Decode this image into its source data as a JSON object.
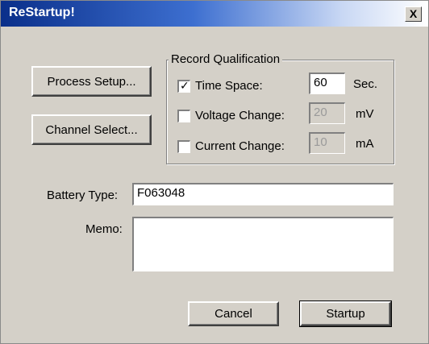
{
  "window": {
    "title": "ReStartup!",
    "close_label": "X"
  },
  "buttons": {
    "process_setup": "Process Setup...",
    "channel_select": "Channel Select...",
    "cancel": "Cancel",
    "startup": "Startup"
  },
  "record_qualification": {
    "title": "Record Qualification",
    "time_space": {
      "label": "Time Space:",
      "checked": true,
      "value": "60",
      "unit": "Sec."
    },
    "voltage_change": {
      "label": "Voltage Change:",
      "checked": false,
      "value": "20",
      "unit": "mV"
    },
    "current_change": {
      "label": "Current Change:",
      "checked": false,
      "value": "10",
      "unit": "mA"
    }
  },
  "battery_type": {
    "label": "Battery Type:",
    "value": "F063048"
  },
  "memo": {
    "label": "Memo:",
    "value": ""
  }
}
